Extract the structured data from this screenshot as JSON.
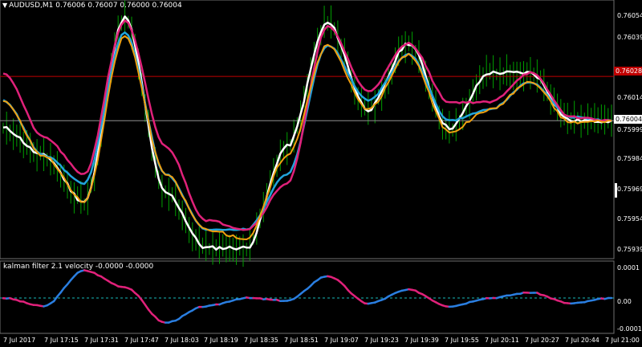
{
  "symbol_header": "AUDUSD,M1  0.76006 0.76007 0.76000 0.76004",
  "indicator_header": "kalman filter 2.1 velocity -0.0000 -0.0000",
  "colors": {
    "background": "#000000",
    "candles": "#00a000",
    "white_line": "#ffffff",
    "cyan_line": "#21a4dc",
    "magenta_line": "#e0217a",
    "orange_line": "#f0a010",
    "red_level": "#c00000",
    "current_price_line": "#909090",
    "velocity_up": "#2a7ee0",
    "velocity_down": "#e0217a",
    "zero_line": "#19b9b9"
  },
  "price_axis": {
    "ticks": [
      "0.76054",
      "0.76039",
      "0.76014",
      "0.75999",
      "0.75984",
      "0.75969",
      "0.75954",
      "0.75939"
    ],
    "red_level_label": "0.76028",
    "current_price_label": "0.76004"
  },
  "indicator_axis": {
    "ticks": [
      "0.0001",
      "0.00",
      "-0.0001"
    ]
  },
  "time_axis": {
    "labels": [
      "7 Jul 2017",
      "7 Jul 17:15",
      "7 Jul 17:31",
      "7 Jul 17:47",
      "7 Jul 18:03",
      "7 Jul 18:19",
      "7 Jul 18:35",
      "7 Jul 18:51",
      "7 Jul 19:07",
      "7 Jul 19:23",
      "7 Jul 19:39",
      "7 Jul 19:55",
      "7 Jul 20:11",
      "7 Jul 20:27",
      "7 Jul 20:44",
      "7 Jul 21:00"
    ]
  },
  "chart_data": [
    {
      "type": "line",
      "title": "AUDUSD,M1",
      "ylim": [
        0.7593,
        0.76066
      ],
      "reference_levels": [
        0.76028,
        0.76004
      ],
      "x": [
        "7 Jul 2017",
        "7 Jul 17:15",
        "7 Jul 17:31",
        "7 Jul 17:47",
        "7 Jul 18:03",
        "7 Jul 18:19",
        "7 Jul 18:35",
        "7 Jul 18:51",
        "7 Jul 19:07",
        "7 Jul 19:23",
        "7 Jul 19:39",
        "7 Jul 19:55",
        "7 Jul 20:11",
        "7 Jul 20:27",
        "7 Jul 20:44",
        "7 Jul 21:00"
      ],
      "series": [
        {
          "values": [
            0.76,
            0.75985,
            0.7596,
            0.7606,
            0.75965,
            0.75935,
            0.75935,
            0.7599,
            0.76057,
            0.7601,
            0.76046,
            0.76,
            0.7603,
            0.7603,
            0.76004,
            0.76004
          ]
        },
        {
          "values": [
            0.76015,
            0.75985,
            0.7597,
            0.76052,
            0.75975,
            0.75945,
            0.75945,
            0.75975,
            0.76045,
            0.76015,
            0.7604,
            0.76004,
            0.7601,
            0.76025,
            0.76006,
            0.76004
          ]
        },
        {
          "values": [
            0.7603,
            0.75995,
            0.75975,
            0.76058,
            0.7599,
            0.7595,
            0.75945,
            0.7597,
            0.76055,
            0.7602,
            0.76046,
            0.76014,
            0.76014,
            0.7603,
            0.76006,
            0.76004
          ]
        },
        {
          "values": [
            0.76015,
            0.75985,
            0.7596,
            0.7605,
            0.75975,
            0.75945,
            0.7594,
            0.75985,
            0.76045,
            0.7601,
            0.7604,
            0.75998,
            0.7601,
            0.76025,
            0.76003,
            0.76004
          ]
        }
      ]
    },
    {
      "type": "line",
      "title": "kalman filter 2.1 velocity",
      "ylim": [
        -0.00012,
        0.00012
      ],
      "x": [
        "7 Jul 2017",
        "7 Jul 17:15",
        "7 Jul 17:31",
        "7 Jul 17:47",
        "7 Jul 18:03",
        "7 Jul 18:19",
        "7 Jul 18:35",
        "7 Jul 18:51",
        "7 Jul 19:07",
        "7 Jul 19:23",
        "7 Jul 19:39",
        "7 Jul 19:55",
        "7 Jul 20:11",
        "7 Jul 20:27",
        "7 Jul 20:44",
        "7 Jul 21:00"
      ],
      "series": [
        {
          "values": [
            0.0,
            -3e-05,
            0.0001,
            4e-05,
            -9e-05,
            -3e-05,
            0.0,
            -1e-05,
            8e-05,
            -2e-05,
            3e-05,
            -3e-05,
            0.0,
            2e-05,
            -2e-05,
            0.0
          ]
        }
      ]
    }
  ]
}
